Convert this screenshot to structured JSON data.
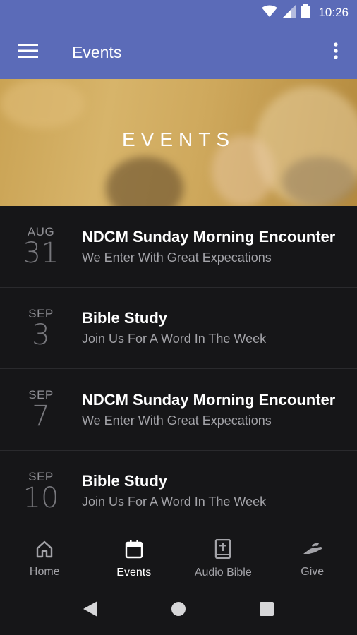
{
  "status_bar": {
    "time": "10:26"
  },
  "app_bar": {
    "title": "Events"
  },
  "hero": {
    "title": "EVENTS"
  },
  "events": [
    {
      "month": "AUG",
      "day": "31",
      "title": "NDCM Sunday Morning Encounter",
      "subtitle": "We Enter With Great Expecations"
    },
    {
      "month": "SEP",
      "day": "3",
      "title": "Bible Study",
      "subtitle": "Join Us For A Word In The Week"
    },
    {
      "month": "SEP",
      "day": "7",
      "title": "NDCM Sunday Morning Encounter",
      "subtitle": "We Enter With Great Expecations"
    },
    {
      "month": "SEP",
      "day": "10",
      "title": "Bible Study",
      "subtitle": "Join Us For A Word In The Week"
    }
  ],
  "bottom_nav": {
    "active": "Events",
    "items": [
      {
        "label": "Home",
        "icon": "home-icon"
      },
      {
        "label": "Events",
        "icon": "calendar-icon"
      },
      {
        "label": "Audio Bible",
        "icon": "bible-icon"
      },
      {
        "label": "Give",
        "icon": "give-hand-icon"
      }
    ]
  },
  "colors": {
    "app_bar": "#5b6bb8",
    "background": "#161618",
    "hero_tint": "#caa354"
  }
}
